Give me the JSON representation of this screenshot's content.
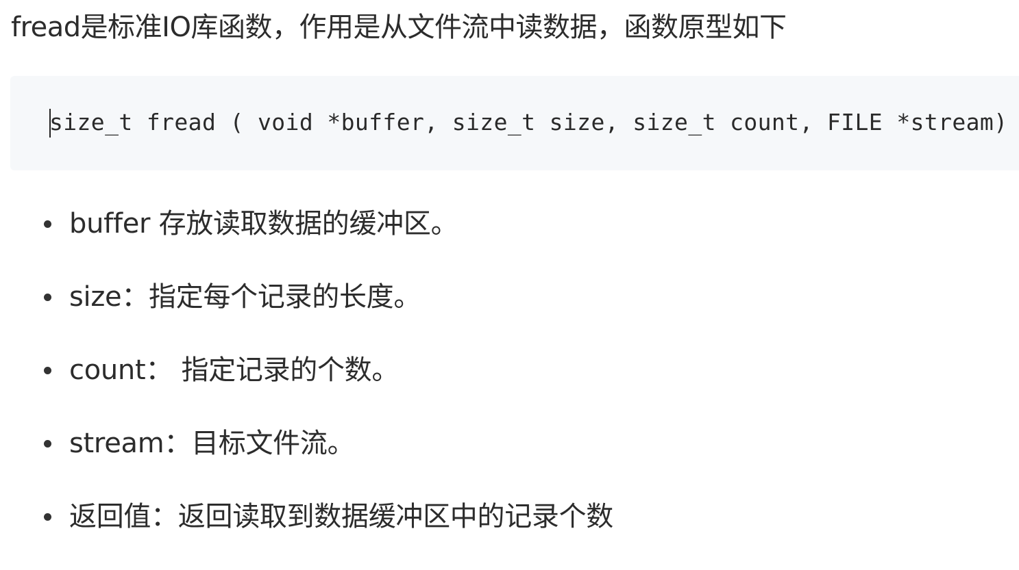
{
  "intro": "fread是标准IO库函数，作用是从文件流中读数据，函数原型如下",
  "code": "size_t fread ( void *buffer, size_t size, size_t count, FILE *stream) ;",
  "params": [
    "buffer 存放读取数据的缓冲区。",
    "size：指定每个记录的长度。",
    "count： 指定记录的个数。",
    "stream：目标文件流。",
    "返回值：返回读取到数据缓冲区中的记录个数"
  ],
  "colors": {
    "text": "#2c2c2c",
    "code_background": "#f6f8fa"
  }
}
